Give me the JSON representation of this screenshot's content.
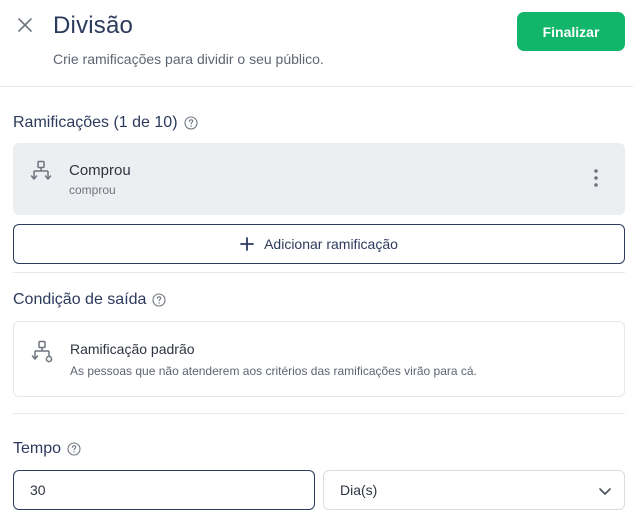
{
  "header": {
    "title": "Divisão",
    "subtitle": "Crie ramificações para dividir o seu público.",
    "finish_label": "Finalizar"
  },
  "branches_section": {
    "title": "Ramificações (1 de 10)",
    "branches": [
      {
        "name": "Comprou",
        "description": "comprou"
      }
    ],
    "add_label": "Adicionar ramificação"
  },
  "exit_section": {
    "title": "Condição de saída",
    "default_branch_name": "Ramificação padrão",
    "default_branch_description": "As pessoas que não atenderem aos critérios das ramificações virão para cá."
  },
  "time_section": {
    "title": "Tempo",
    "value": "30",
    "unit": "Dia(s)"
  },
  "colors": {
    "primary": "#12b66b",
    "navy": "#2c3a5c",
    "card_bg": "#eceef1"
  }
}
